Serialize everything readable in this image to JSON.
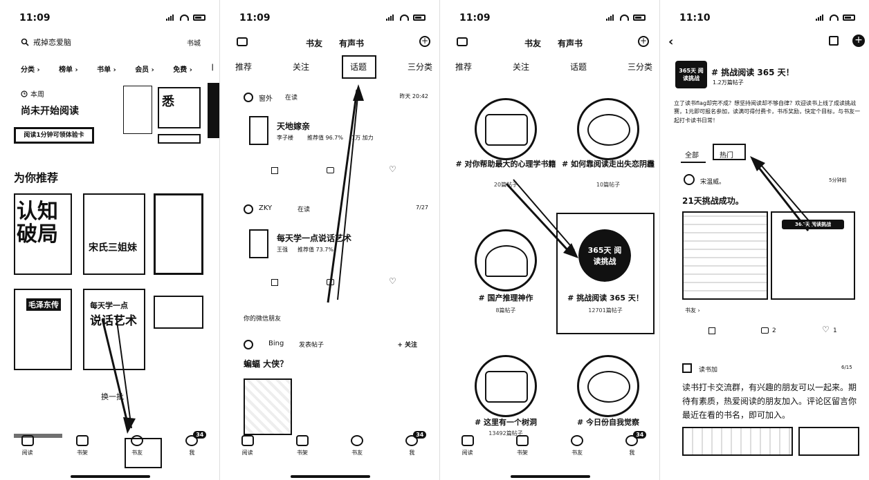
{
  "status": {
    "time1": "11:09",
    "time2": "11:09",
    "time3": "11:09",
    "time4": "11:10"
  },
  "tabbar": {
    "items": [
      "阅读",
      "书架",
      "书友",
      "我"
    ],
    "badge": "34"
  },
  "panel1": {
    "search_placeholder": "戒掉恋爱脑",
    "bookstore": "书城",
    "cats": [
      "分类 ›",
      "榜单 ›",
      "书单 ›",
      "会员 ›",
      "免费 ›"
    ],
    "week_label": "本周",
    "reading_status": "尚未开始阅读",
    "banner": "阅读1分钟可领体验卡",
    "recommend_title": "为你推荐",
    "book1": "认知破局",
    "book2": "宋氏三姐妹",
    "book4": "毛泽东传",
    "book5_line1": "每天学一点",
    "book5_line2": "说话艺术",
    "refresh": "换一批"
  },
  "panel2": {
    "header_friends": "书友",
    "header_audio": "有声书",
    "tabs": [
      "推荐",
      "关注",
      "话题",
      "三分类"
    ],
    "post1_user": "窗外",
    "post1_status": "在读",
    "post1_time": "昨天 20:42",
    "post1_book": "天地嫁亲",
    "post1_author": "李子楼",
    "post1_rate": "推荐值 96.7%",
    "post1_extra": "1万 加力",
    "post2_user": "ZKY",
    "post2_status": "在读",
    "post2_time": "7/27",
    "post2_book": "每天学一点说话艺术",
    "post2_author": "王强",
    "post2_rate": "推荐值 73.7%",
    "wechat_friends": "你的微信朋友",
    "post3_user": "Bing",
    "post3_action": "发表帖子",
    "follow": "+ 关注",
    "post3_text": "蝙蝠 大侠？"
  },
  "panel3": {
    "topics": [
      {
        "title": "# 对你帮助最大的心理学书籍",
        "count": "20篇帖子"
      },
      {
        "title": "# 如何靠阅读走出失恋阴霾",
        "count": "10篇帖子"
      },
      {
        "title": "# 国产推理神作",
        "count": "8篇帖子"
      },
      {
        "title": "# 挑战阅读 365 天！",
        "count": "12701篇帖子"
      },
      {
        "title": "# 这里有一个树洞",
        "count": "13492篇帖子"
      },
      {
        "title": "# 今日份自我觉察",
        "count": "—"
      }
    ],
    "seal_text": "365天 阅读挑战"
  },
  "panel4": {
    "topic_title": "# 挑战阅读 365 天！",
    "topic_count": "1.2万篇帖子",
    "seal_text": "365天 阅读挑战",
    "intro": "立了读书flag却完不成？想坚持阅读却不够自律？欢迎读书上线了成读挑战赛，1元即可报名参加，读满可得付费卡，书币奖励，快定个目标，与书友一起打卡读书日常！",
    "tab_all": "全部",
    "tab_hot": "热门",
    "post_user": "宋温威。",
    "post_time": "5分钟前",
    "post_text": "21天挑战成功。",
    "friend_tag": "书友 ›",
    "comments": "2",
    "likes": "1",
    "post2_user": "读书加",
    "post2_time": "6/15",
    "post2_text": "读书打卡交流群，有兴趣的朋友可以一起来。期待有素质，热爱阅读的朋友加入。评论区留言你最近在看的书名，即可加入。"
  }
}
